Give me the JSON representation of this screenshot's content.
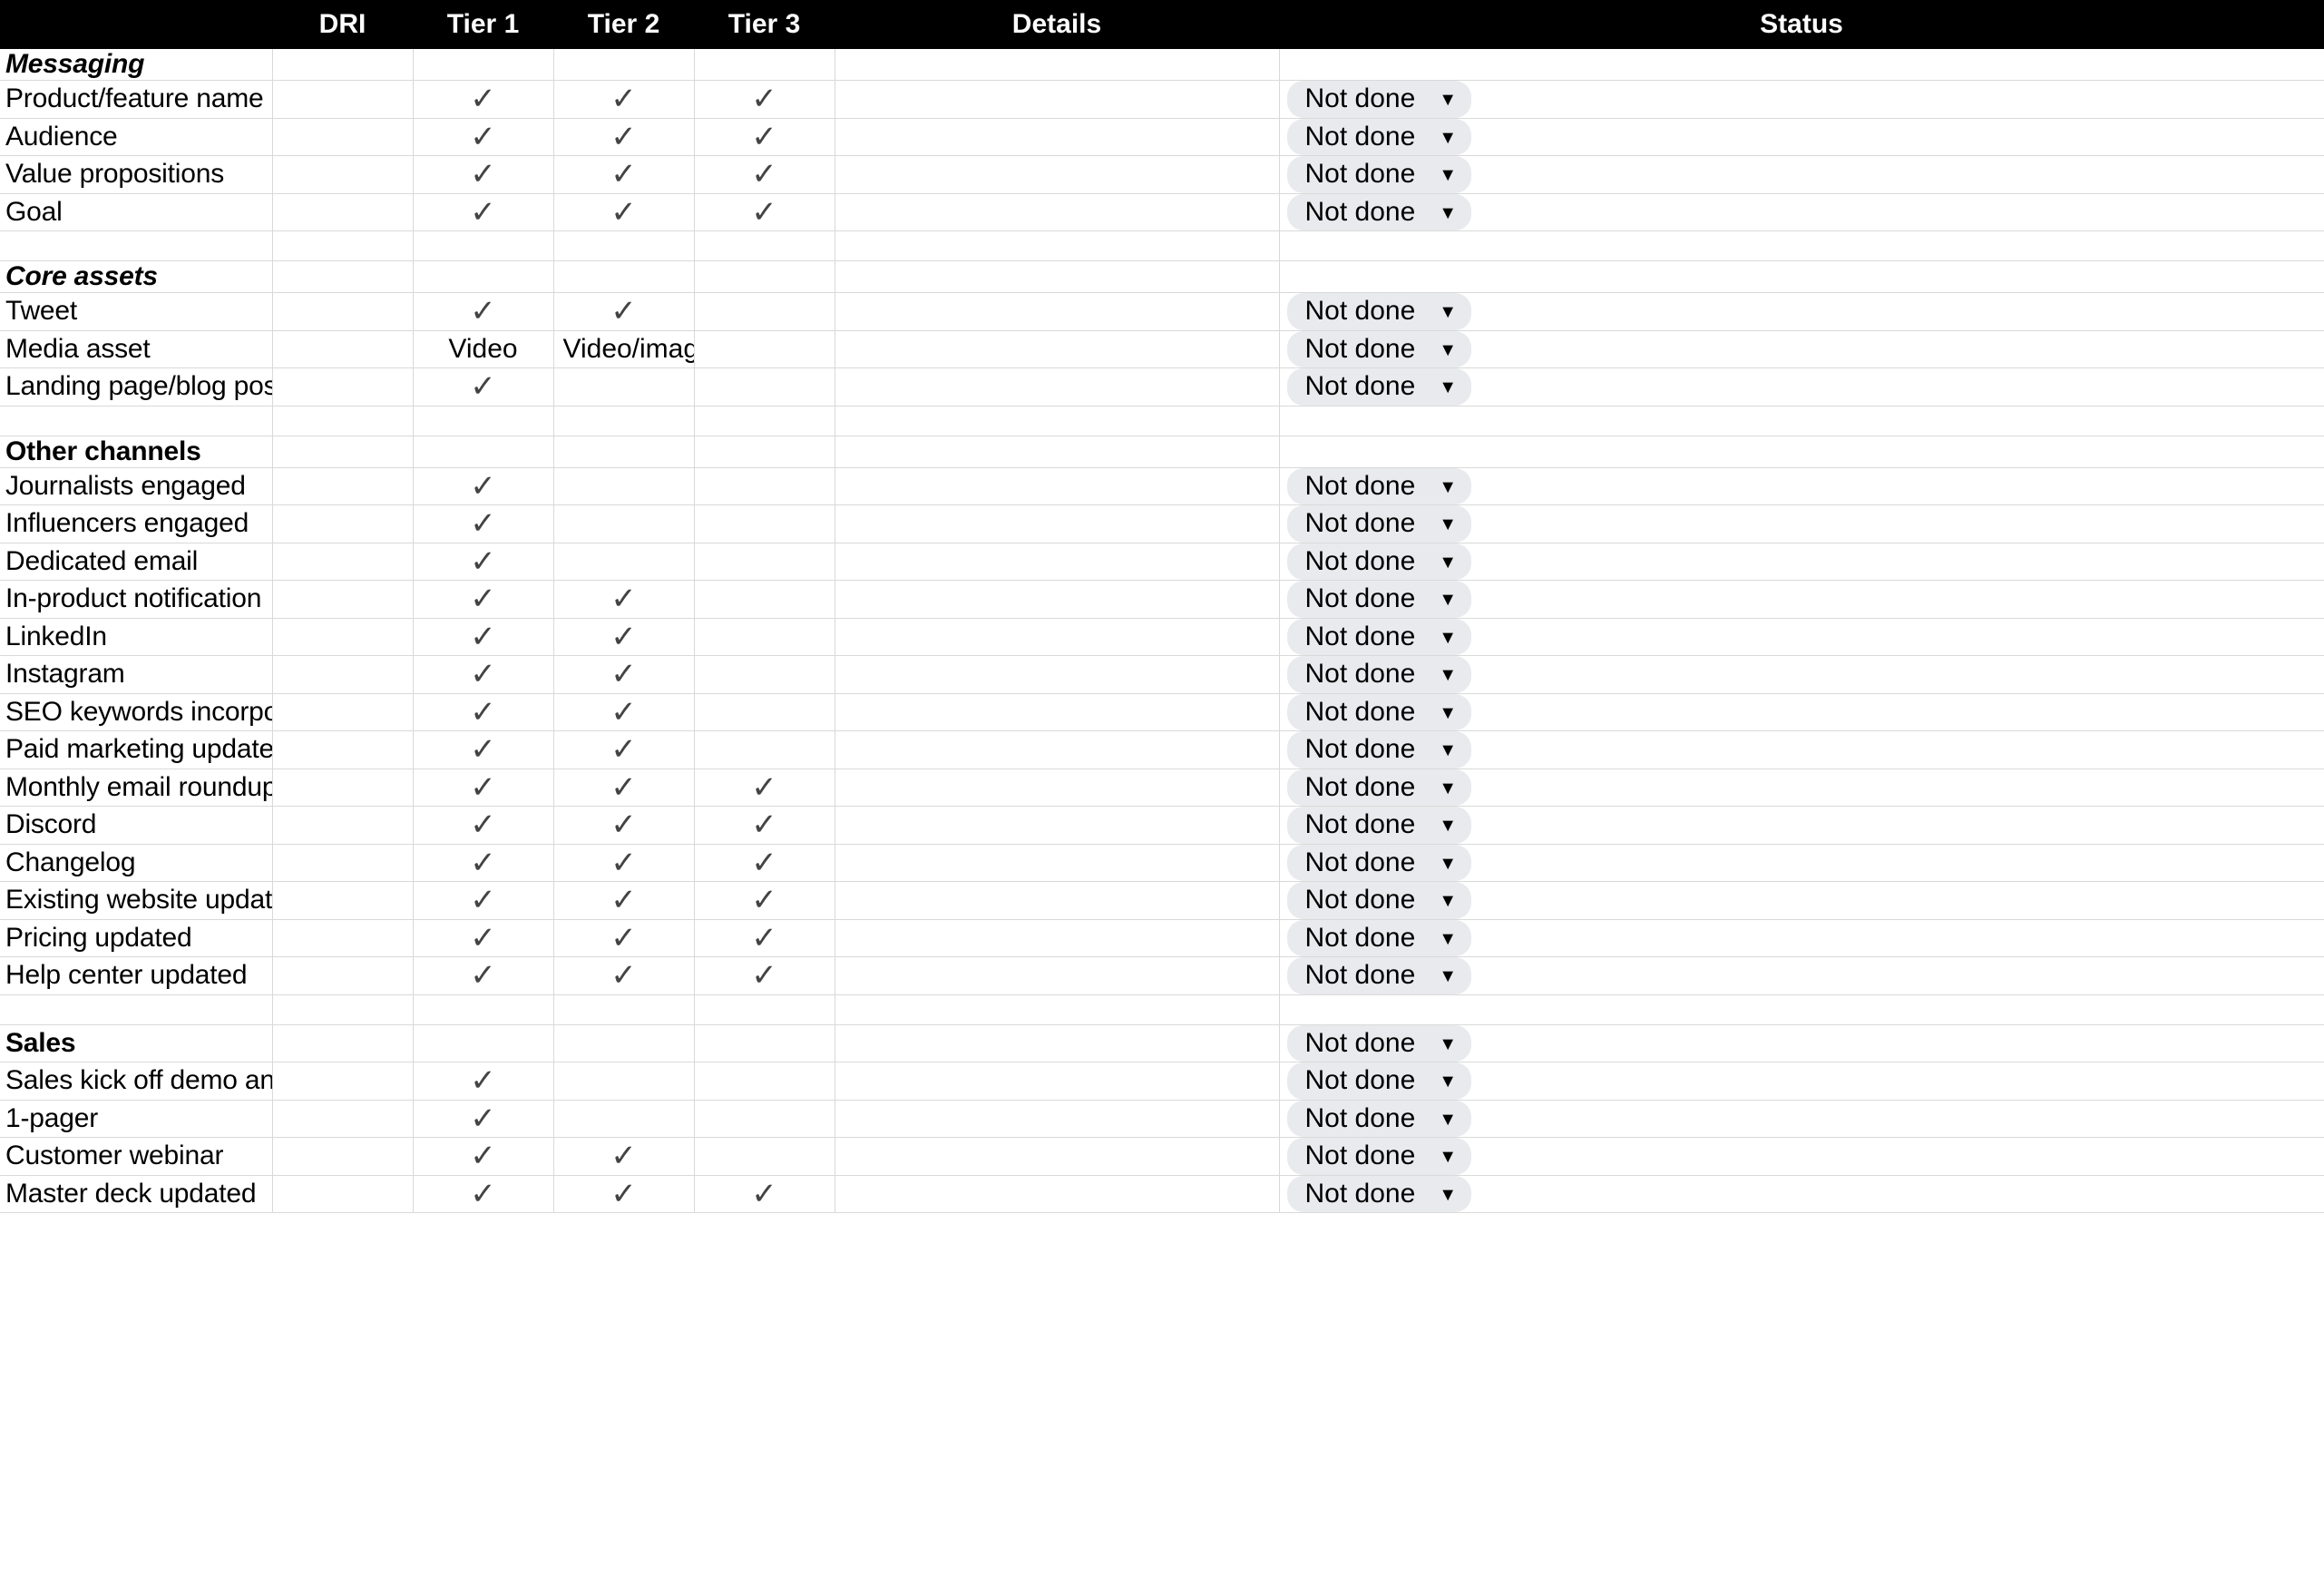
{
  "table": {
    "columns": [
      {
        "key": "task",
        "label": "",
        "align": "left"
      },
      {
        "key": "dri",
        "label": "DRI",
        "align": "center"
      },
      {
        "key": "tier1",
        "label": "Tier 1",
        "align": "center"
      },
      {
        "key": "tier2",
        "label": "Tier 2",
        "align": "center"
      },
      {
        "key": "tier3",
        "label": "Tier 3",
        "align": "center"
      },
      {
        "key": "details",
        "label": "Details",
        "align": "center"
      },
      {
        "key": "status",
        "label": "Status",
        "align": "center"
      }
    ],
    "check_glyph": "✓",
    "caret_glyph": "▼",
    "status_default": "Not done",
    "colors": {
      "header_background": "#000000",
      "header_text": "#ffffff",
      "grid_line": "#d9d9d9",
      "check_mark": "#434343",
      "chip_background": "#e8eaed",
      "chip_text": "#000000",
      "page_background": "#ffffff"
    },
    "rows": [
      {
        "type": "section",
        "italic": true,
        "task": "Messaging",
        "dri": "",
        "tier1": "",
        "tier2": "",
        "tier3": "",
        "details": "",
        "status": ""
      },
      {
        "type": "item",
        "task": "Product/feature name",
        "dri": "",
        "tier1": "✓",
        "tier2": "✓",
        "tier3": "✓",
        "details": "",
        "status": "Not done"
      },
      {
        "type": "item",
        "task": "Audience",
        "dri": "",
        "tier1": "✓",
        "tier2": "✓",
        "tier3": "✓",
        "details": "",
        "status": "Not done"
      },
      {
        "type": "item",
        "task": "Value propositions",
        "dri": "",
        "tier1": "✓",
        "tier2": "✓",
        "tier3": "✓",
        "details": "",
        "status": "Not done"
      },
      {
        "type": "item",
        "task": "Goal",
        "dri": "",
        "tier1": "✓",
        "tier2": "✓",
        "tier3": "✓",
        "details": "",
        "status": "Not done"
      },
      {
        "type": "spacer",
        "task": "",
        "dri": "",
        "tier1": "",
        "tier2": "",
        "tier3": "",
        "details": "",
        "status": ""
      },
      {
        "type": "section",
        "italic": true,
        "task": "Core assets",
        "dri": "",
        "tier1": "",
        "tier2": "",
        "tier3": "",
        "details": "",
        "status": ""
      },
      {
        "type": "item",
        "task": "Tweet",
        "dri": "",
        "tier1": "✓",
        "tier2": "✓",
        "tier3": "",
        "details": "",
        "status": "Not done"
      },
      {
        "type": "item",
        "task": "Media asset",
        "dri": "",
        "tier1": "Video",
        "tier2": "Video/image",
        "tier3": "",
        "details": "",
        "status": "Not done"
      },
      {
        "type": "item",
        "task": "Landing page/blog post",
        "dri": "",
        "tier1": "✓",
        "tier2": "",
        "tier3": "",
        "details": "",
        "status": "Not done"
      },
      {
        "type": "spacer",
        "task": "",
        "dri": "",
        "tier1": "",
        "tier2": "",
        "tier3": "",
        "details": "",
        "status": ""
      },
      {
        "type": "section",
        "italic": false,
        "task": "Other channels",
        "dri": "",
        "tier1": "",
        "tier2": "",
        "tier3": "",
        "details": "",
        "status": ""
      },
      {
        "type": "item",
        "task": "Journalists engaged",
        "dri": "",
        "tier1": "✓",
        "tier2": "",
        "tier3": "",
        "details": "",
        "status": "Not done"
      },
      {
        "type": "item",
        "task": "Influencers engaged",
        "dri": "",
        "tier1": "✓",
        "tier2": "",
        "tier3": "",
        "details": "",
        "status": "Not done"
      },
      {
        "type": "item",
        "task": "Dedicated email",
        "dri": "",
        "tier1": "✓",
        "tier2": "",
        "tier3": "",
        "details": "",
        "status": "Not done"
      },
      {
        "type": "item",
        "task": "In-product notification",
        "dri": "",
        "tier1": "✓",
        "tier2": "✓",
        "tier3": "",
        "details": "",
        "status": "Not done"
      },
      {
        "type": "item",
        "task": "LinkedIn",
        "dri": "",
        "tier1": "✓",
        "tier2": "✓",
        "tier3": "",
        "details": "",
        "status": "Not done"
      },
      {
        "type": "item",
        "task": "Instagram",
        "dri": "",
        "tier1": "✓",
        "tier2": "✓",
        "tier3": "",
        "details": "",
        "status": "Not done"
      },
      {
        "type": "item",
        "task": "SEO keywords incorporated",
        "dri": "",
        "tier1": "✓",
        "tier2": "✓",
        "tier3": "",
        "details": "",
        "status": "Not done"
      },
      {
        "type": "item",
        "task": "Paid marketing updated",
        "dri": "",
        "tier1": "✓",
        "tier2": "✓",
        "tier3": "",
        "details": "",
        "status": "Not done"
      },
      {
        "type": "item",
        "task": "Monthly email roundup",
        "dri": "",
        "tier1": "✓",
        "tier2": "✓",
        "tier3": "✓",
        "details": "",
        "status": "Not done"
      },
      {
        "type": "item",
        "task": "Discord",
        "dri": "",
        "tier1": "✓",
        "tier2": "✓",
        "tier3": "✓",
        "details": "",
        "status": "Not done"
      },
      {
        "type": "item",
        "task": "Changelog",
        "dri": "",
        "tier1": "✓",
        "tier2": "✓",
        "tier3": "✓",
        "details": "",
        "status": "Not done"
      },
      {
        "type": "item",
        "task": "Existing website updated",
        "dri": "",
        "tier1": "✓",
        "tier2": "✓",
        "tier3": "✓",
        "details": "",
        "status": "Not done"
      },
      {
        "type": "item",
        "task": "Pricing updated",
        "dri": "",
        "tier1": "✓",
        "tier2": "✓",
        "tier3": "✓",
        "details": "",
        "status": "Not done"
      },
      {
        "type": "item",
        "task": "Help center updated",
        "dri": "",
        "tier1": "✓",
        "tier2": "✓",
        "tier3": "✓",
        "details": "",
        "status": "Not done"
      },
      {
        "type": "spacer",
        "task": "",
        "dri": "",
        "tier1": "",
        "tier2": "",
        "tier3": "",
        "details": "",
        "status": ""
      },
      {
        "type": "section",
        "italic": false,
        "task": "Sales",
        "dri": "",
        "tier1": "",
        "tier2": "",
        "tier3": "",
        "details": "",
        "status": "Not done"
      },
      {
        "type": "item",
        "task": "Sales kick off demo and Q&A",
        "dri": "",
        "tier1": "✓",
        "tier2": "",
        "tier3": "",
        "details": "",
        "status": "Not done"
      },
      {
        "type": "item",
        "task": "1-pager",
        "dri": "",
        "tier1": "✓",
        "tier2": "",
        "tier3": "",
        "details": "",
        "status": "Not done"
      },
      {
        "type": "item",
        "task": "Customer webinar",
        "dri": "",
        "tier1": "✓",
        "tier2": "✓",
        "tier3": "",
        "details": "",
        "status": "Not done"
      },
      {
        "type": "item",
        "task": "Master deck updated",
        "dri": "",
        "tier1": "✓",
        "tier2": "✓",
        "tier3": "✓",
        "details": "",
        "status": "Not done"
      }
    ]
  }
}
